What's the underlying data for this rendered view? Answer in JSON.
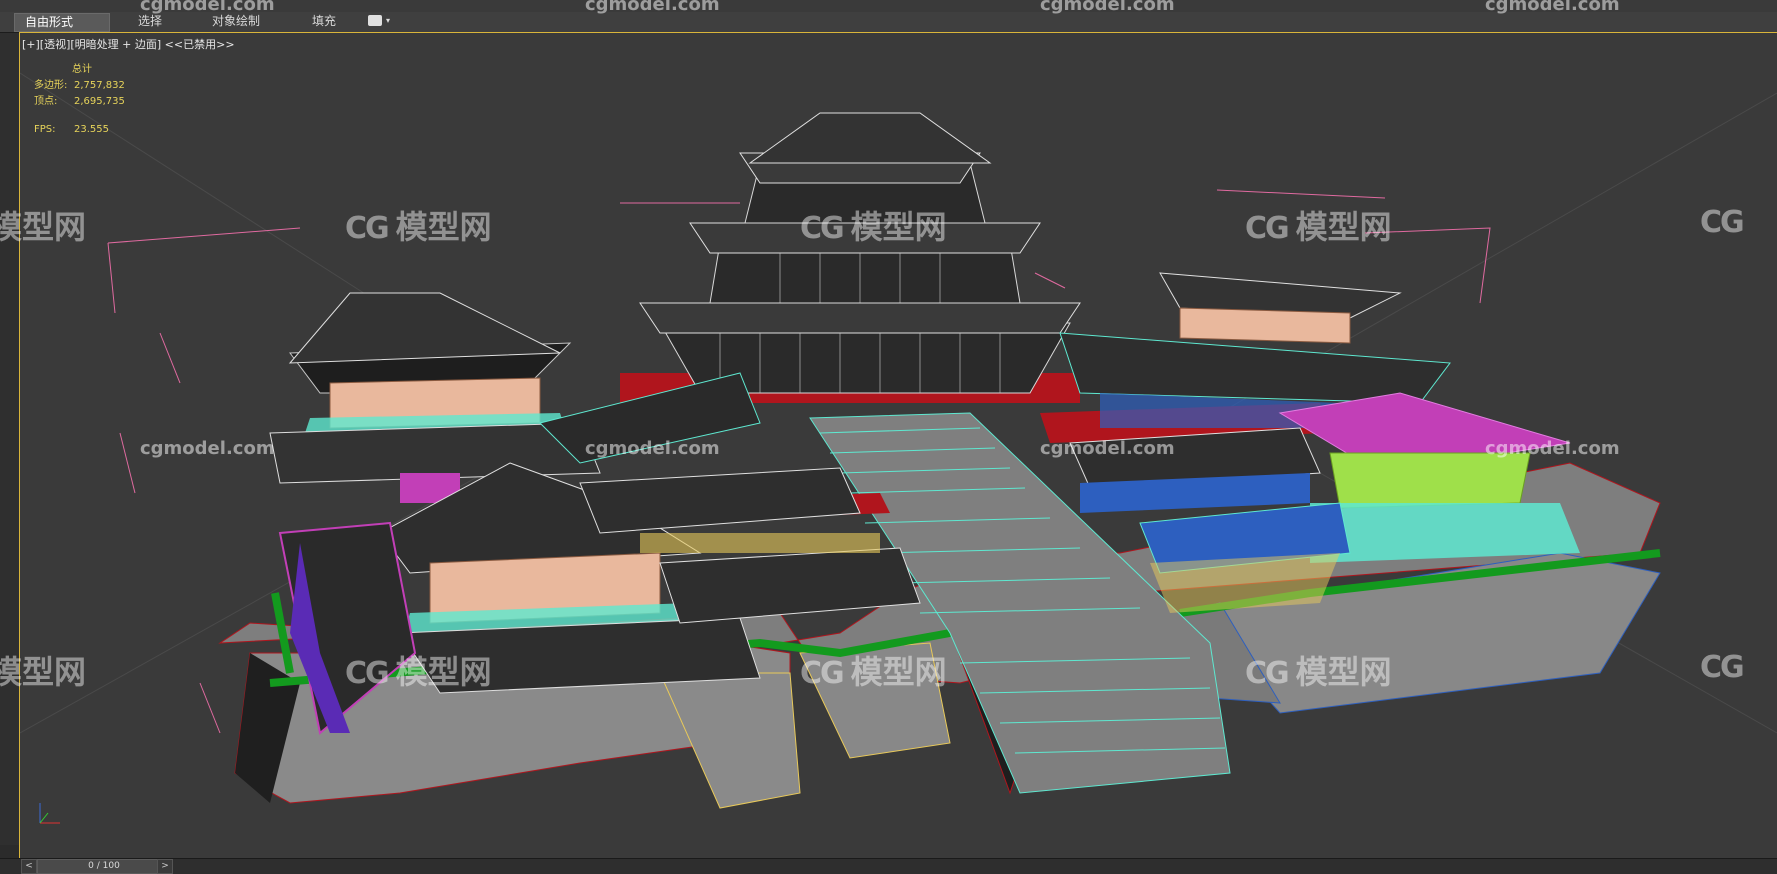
{
  "ribbon": {
    "tabs": [
      {
        "label": "自由形式",
        "active": true
      },
      {
        "label": "选择"
      },
      {
        "label": "对象绘制"
      },
      {
        "label": "填充"
      }
    ]
  },
  "viewport": {
    "label": "[+][透视][明暗处理 + 边面] <<已禁用>>",
    "stats": {
      "header": "总计",
      "polys_label": "多边形:",
      "polys_value": "2,757,832",
      "verts_label": "顶点:",
      "verts_value": "2,695,735",
      "fps_label": "FPS:",
      "fps_value": "23.555"
    }
  },
  "watermarks": {
    "brand_cn": "模型网",
    "brand_en": "cgmodel.com"
  },
  "timeline": {
    "frame": "0 / 100",
    "prev": "<",
    "next": ">"
  },
  "colors": {
    "viewport_border": "#d9b53a",
    "stats_text": "#e6d35a",
    "wire_cyan": "#5ee8d0",
    "wire_magenta": "#c23fb7",
    "wire_red": "#b0151d",
    "wire_green": "#139a1e",
    "wire_blue": "#2d5fbf",
    "wire_yellow": "#e8c95a",
    "wire_peach": "#e9b89d",
    "wire_lime": "#9fe04a"
  }
}
